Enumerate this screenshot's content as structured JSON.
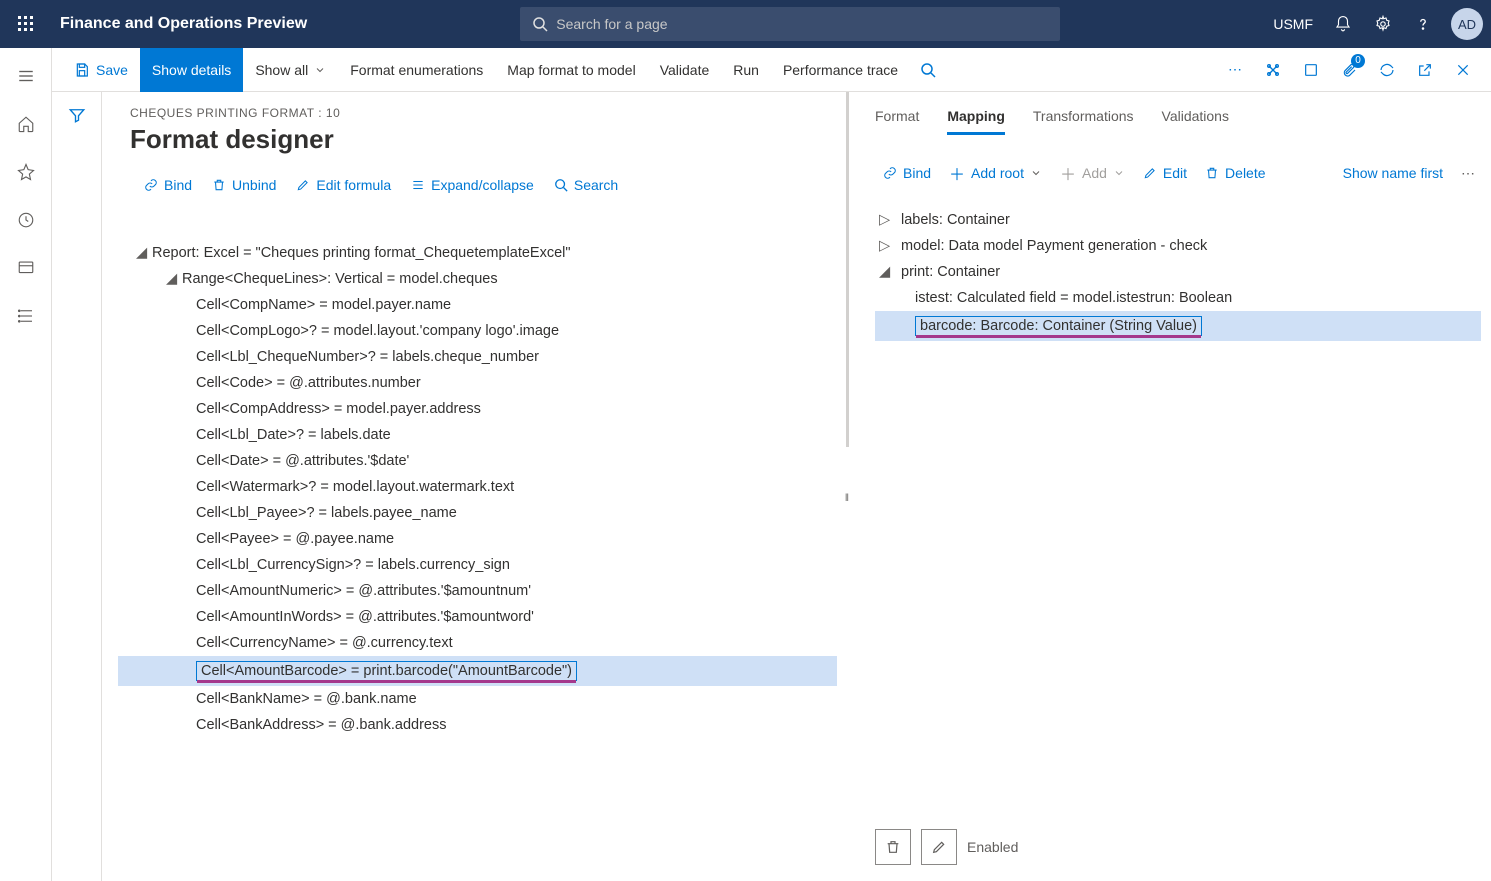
{
  "header": {
    "app_title": "Finance and Operations Preview",
    "search_placeholder": "Search for a page",
    "company": "USMF",
    "avatar": "AD"
  },
  "actionbar": {
    "save": "Save",
    "show_details": "Show details",
    "show_all": "Show all",
    "format_enum": "Format enumerations",
    "map_format": "Map format to model",
    "validate": "Validate",
    "run": "Run",
    "perf_trace": "Performance trace",
    "badge_count": "0"
  },
  "page": {
    "breadcrumb": "CHEQUES PRINTING FORMAT : 10",
    "title": "Format designer"
  },
  "left_toolbar": {
    "bind": "Bind",
    "unbind": "Unbind",
    "edit_formula": "Edit formula",
    "expand": "Expand/collapse",
    "search": "Search"
  },
  "tree": {
    "root": "Report: Excel = \"Cheques printing format_ChequetemplateExcel\"",
    "range": "Range<ChequeLines>: Vertical = model.cheques",
    "cells": [
      "Cell<CompName> = model.payer.name",
      "Cell<CompLogo>? = model.layout.'company logo'.image",
      "Cell<Lbl_ChequeNumber>? = labels.cheque_number",
      "Cell<Code> = @.attributes.number",
      "Cell<CompAddress> = model.payer.address",
      "Cell<Lbl_Date>? = labels.date",
      "Cell<Date> = @.attributes.'$date'",
      "Cell<Watermark>? = model.layout.watermark.text",
      "Cell<Lbl_Payee>? = labels.payee_name",
      "Cell<Payee> = @.payee.name",
      "Cell<Lbl_CurrencySign>? = labels.currency_sign",
      "Cell<AmountNumeric> = @.attributes.'$amountnum'",
      "Cell<AmountInWords> = @.attributes.'$amountword'",
      "Cell<CurrencyName> = @.currency.text",
      "Cell<AmountBarcode> = print.barcode(\"AmountBarcode\")",
      "Cell<BankName> = @.bank.name",
      "Cell<BankAddress> = @.bank.address"
    ],
    "selected_index": 14
  },
  "right": {
    "tabs": {
      "format": "Format",
      "mapping": "Mapping",
      "transformations": "Transformations",
      "validations": "Validations"
    },
    "toolbar": {
      "bind": "Bind",
      "add_root": "Add root",
      "add": "Add",
      "edit": "Edit",
      "delete": "Delete",
      "show_name": "Show name first"
    },
    "tree": {
      "labels": "labels: Container",
      "model": "model: Data model Payment generation - check",
      "print": "print: Container",
      "istest": "istest: Calculated field = model.istestrun: Boolean",
      "barcode": "barcode: Barcode: Container (String Value)"
    },
    "footer": {
      "enabled": "Enabled"
    }
  }
}
